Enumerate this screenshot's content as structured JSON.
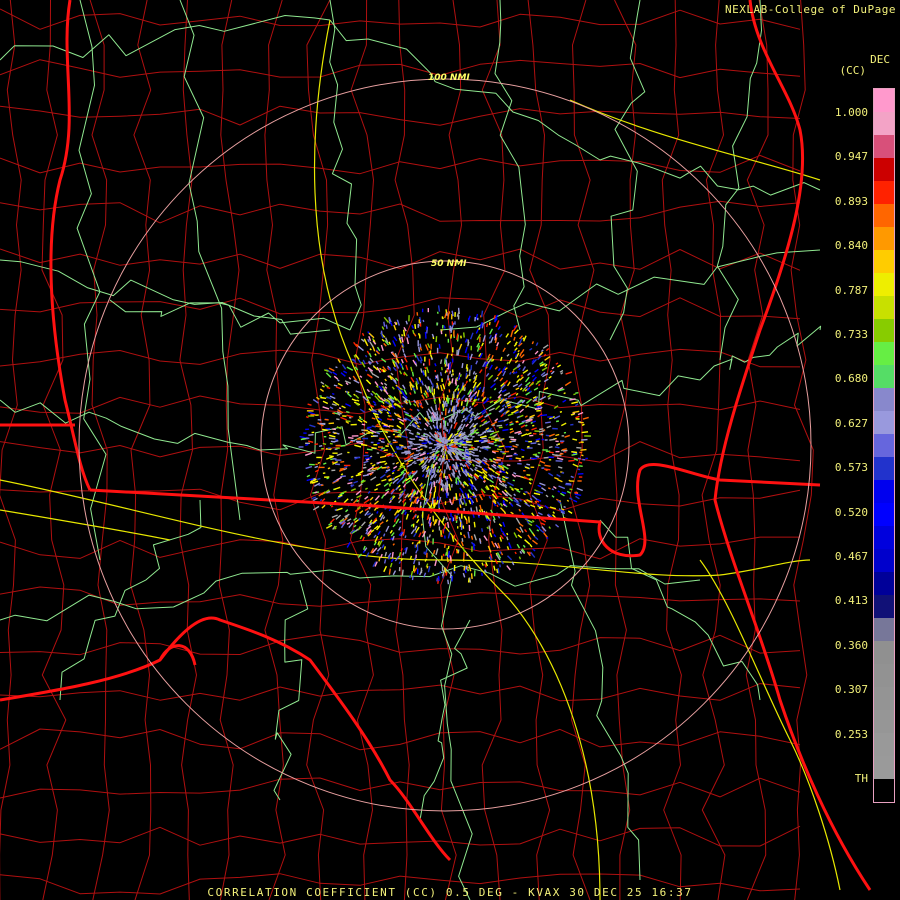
{
  "header": {
    "credit": "NEXLAB-College of DuPage"
  },
  "product": {
    "caption": "CORRELATION COEFFICIENT (CC) 0.5 DEG - KVAX 30 DEC 25 16:37",
    "units_line1": "DEC",
    "units_line2": "(CC)"
  },
  "range_rings": [
    {
      "label": "50 NMI"
    },
    {
      "label": "100 NMI"
    }
  ],
  "legend": {
    "labels": [
      "1.000",
      "0.947",
      "0.893",
      "0.840",
      "0.787",
      "0.733",
      "0.680",
      "0.627",
      "0.573",
      "0.520",
      "0.467",
      "0.413",
      "0.360",
      "0.307",
      "0.253",
      "TH"
    ],
    "colors": [
      "#ff99cc",
      "#f3a3c6",
      "#d8507a",
      "#cc0000",
      "#ff2200",
      "#ff6600",
      "#ff9900",
      "#ffcc00",
      "#eeee00",
      "#c8e000",
      "#88cc00",
      "#66ee44",
      "#55dd66",
      "#8888cc",
      "#9999dd",
      "#6666dd",
      "#2233cc",
      "#0000ee",
      "#0000ff",
      "#0000dd",
      "#0000cc",
      "#000099",
      "#111177",
      "#777799",
      "#909090",
      "#929292",
      "#949494",
      "#969696",
      "#999999",
      "#9a9a9a",
      "#000000"
    ]
  },
  "colors": {
    "state_border": "#ff1111",
    "county_border": "#b01010",
    "interstate": "#e8e800",
    "highway": "#90e890",
    "range_ring": "#e8a0a0"
  }
}
